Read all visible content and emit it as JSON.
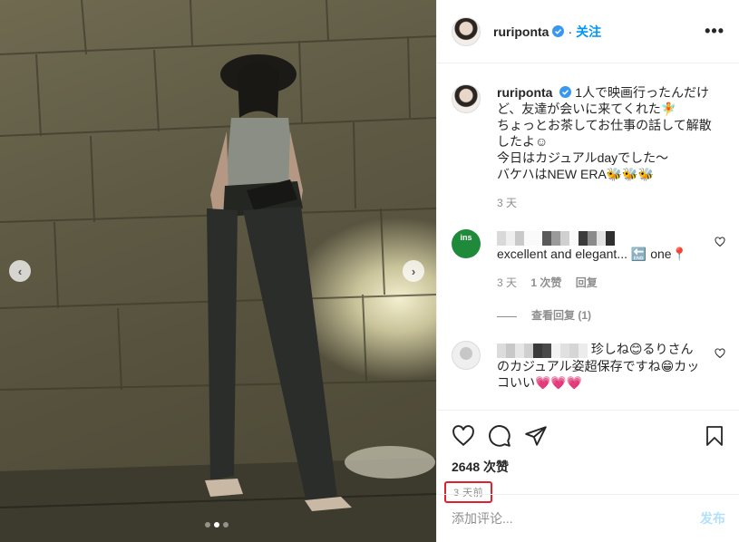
{
  "post": {
    "username": "ruriponta",
    "follow_label": "关注",
    "more_label": "•••",
    "photo_alt": "woman in bucket hat standing in front of stone wall at night",
    "carousel": {
      "dots": 3,
      "active_index": 1
    }
  },
  "caption": {
    "username": "ruriponta",
    "lines": [
      "1人で映画行ったんだけど、友達が会いに来てくれた🧚",
      "ちょっとお茶してお仕事の話して解散したよ☺",
      "今日はカジュアルdayでした～",
      "バケハはNEW ERA🐝🐝🐝"
    ],
    "time": "3 天"
  },
  "comments": [
    {
      "avatar": "ins",
      "avatar_text": "ins",
      "username_hidden": true,
      "text": "excellent and elegant... 🔚 one📍",
      "time": "3 天",
      "likes": "1 次赞",
      "reply_label": "回复",
      "view_replies": "查看回复 (1)"
    },
    {
      "avatar": "default",
      "username_hidden": true,
      "text_prefix": "珍しね😊るりさんのカジュアル姿超保存ですね😁カッコいい💗💗💗"
    }
  ],
  "actions": {
    "likes": "2648 次赞",
    "timestamp": "3 天前",
    "comment_placeholder": "添加评论...",
    "post_label": "发布"
  },
  "colors": {
    "accent": "#0095f6",
    "highlight_box": "#e0202a"
  }
}
